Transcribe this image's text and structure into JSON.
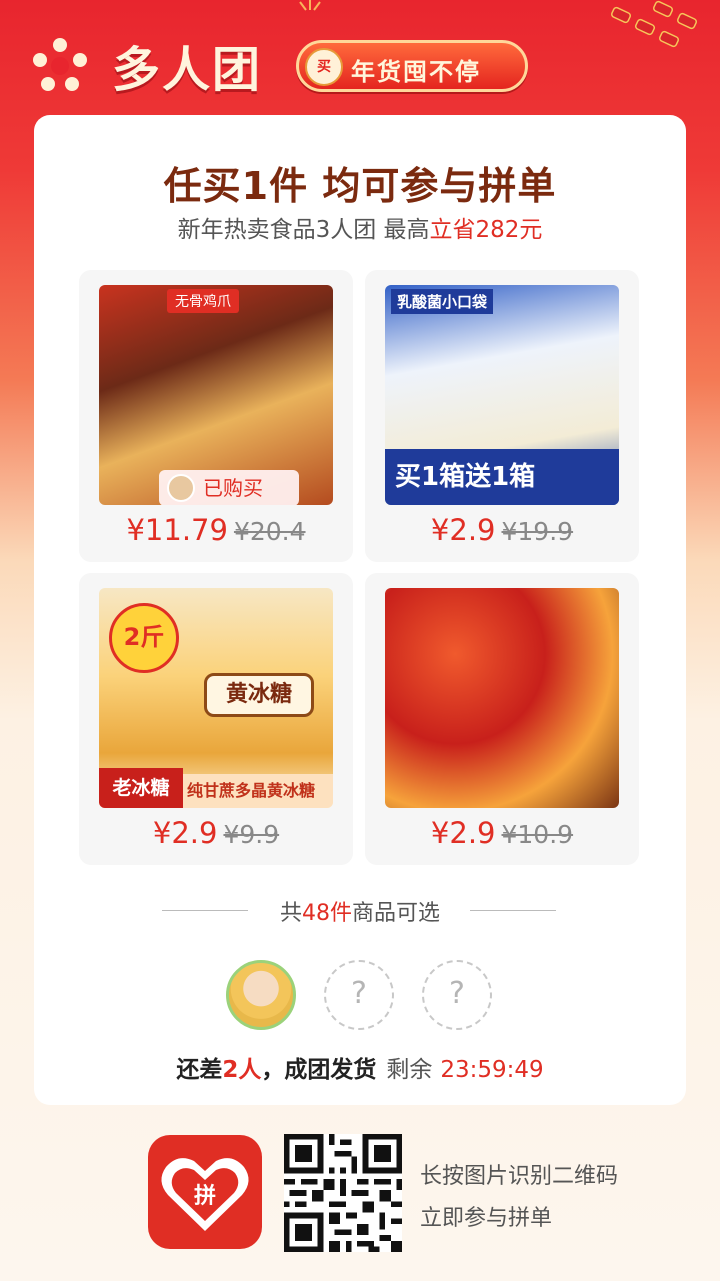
{
  "header": {
    "title": "多人团",
    "promo_icon_text": "买",
    "promo_text": "年货囤不停"
  },
  "card": {
    "headline": "任买1件 均可参与拼单",
    "subline_prefix": "新年热卖食品3人团 最高",
    "subline_highlight": "立省282元"
  },
  "products": [
    {
      "price": "¥11.79",
      "original_price": "¥20.4",
      "image_tag": "无骨鸡爪",
      "bought_label": "已购买"
    },
    {
      "price": "¥2.9",
      "original_price": "¥19.9",
      "image_top": "乳酸菌小口袋",
      "image_banner": "买1箱送1箱"
    },
    {
      "price": "¥2.9",
      "original_price": "¥9.9",
      "image_badge": "2斤",
      "image_label": "黄冰糖",
      "image_bottom_left": "老冰糖",
      "image_bottom": "纯甘蔗多晶黄冰糖"
    },
    {
      "price": "¥2.9",
      "original_price": "¥10.9"
    }
  ],
  "summary": {
    "prefix": "共",
    "count": "48件",
    "suffix": "商品可选"
  },
  "group": {
    "empty_slot_symbol": "?",
    "status_prefix": "还差",
    "status_count": "2人",
    "status_suffix": "，成团发货",
    "remaining_label": "剩余",
    "countdown": "23:59:49"
  },
  "footer": {
    "app_icon_text": "拼",
    "scan_line1": "长按图片识别二维码",
    "scan_line2": "立即参与拼单"
  },
  "colors": {
    "accent_red": "#e02e24",
    "headline_brown": "#7b2a0f"
  }
}
